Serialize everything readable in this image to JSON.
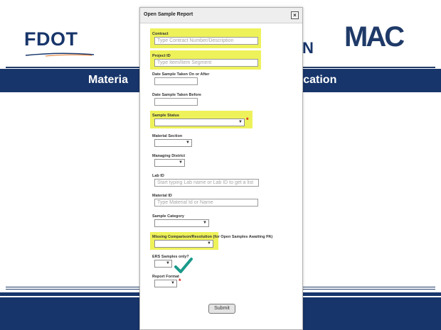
{
  "slide": {
    "logo_left": "FDOT",
    "logo_right": "MAC",
    "header_fragment": "N",
    "band_left": "Materia",
    "band_right": "ification"
  },
  "dialog": {
    "title": "Open Sample Report",
    "close_icon": "close-icon",
    "fields": {
      "contract": {
        "label": "Contract",
        "placeholder": "Type Contract Number/Description"
      },
      "project_id": {
        "label": "Project ID",
        "placeholder": "Type Item/Item Segment"
      },
      "date_after": {
        "label": "Date Sample Taken On or After",
        "value": ""
      },
      "date_before": {
        "label": "Date Sample Taken Before",
        "value": ""
      },
      "sample_status": {
        "label": "Sample Status",
        "value": ""
      },
      "material_section": {
        "label": "Material Section",
        "value": ""
      },
      "managing_district": {
        "label": "Managing District",
        "value": ""
      },
      "lab_id": {
        "label": "Lab ID",
        "placeholder": "Start typing Lab name or Lab ID to get a list"
      },
      "material_id": {
        "label": "Material ID",
        "placeholder": "Type Material Id or Name"
      },
      "sample_category": {
        "label": "Sample Category",
        "value": ""
      },
      "missing_comparison": {
        "label": "Missing Comparison/Resolution (for Open Samples Awaiting PA)",
        "value": ""
      },
      "ers_samples": {
        "label": "ERS Samples only?",
        "value": ""
      },
      "report_format": {
        "label": "Report Format",
        "value": ""
      }
    },
    "required_mark": "*",
    "submit_label": "Submit"
  },
  "colors": {
    "navy": "#17356a",
    "highlight": "#eef25a",
    "required": "#d01010",
    "check": "#1a9a8a"
  }
}
